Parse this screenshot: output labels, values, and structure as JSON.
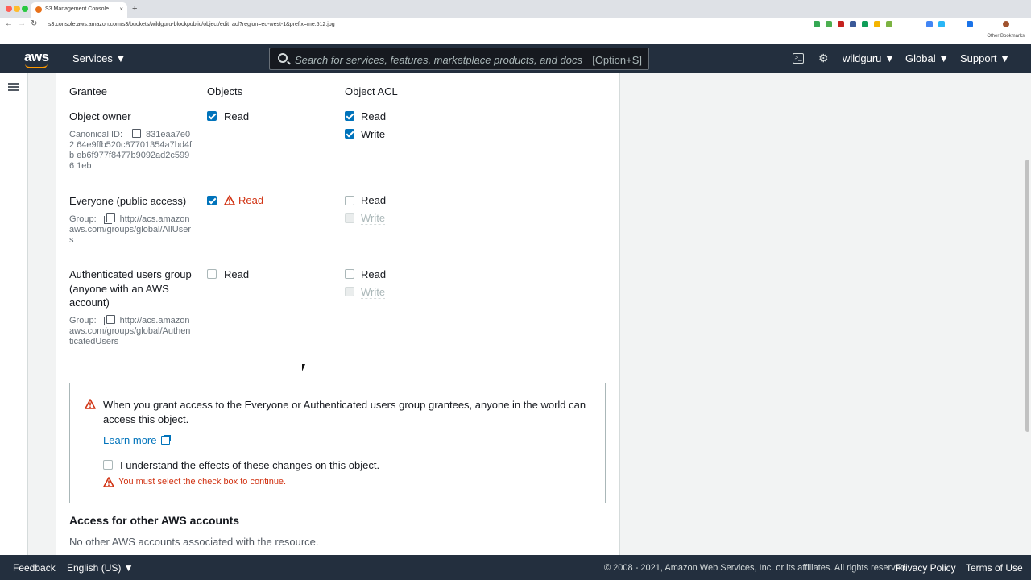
{
  "browser": {
    "tab_title": "S3 Management Console",
    "new_tab": "+",
    "close": "×",
    "url": "s3.console.aws.amazon.com/s3/buckets/wildguru-blockpublic/object/edit_acl?region=eu-west-1&prefix=me.512.jpg",
    "other_bookmarks": "Other Bookmarks"
  },
  "header": {
    "logo": "aws",
    "services": "Services ▼",
    "search_placeholder": "Search for services, features, marketplace products, and docs",
    "search_shortcut": "[Option+S]",
    "cloudshell": ">_",
    "bell": "🔔",
    "account": "wildguru ▼",
    "region": "Global ▼",
    "support": "Support ▼"
  },
  "acl": {
    "col_grantee": "Grantee",
    "col_objects": "Objects",
    "col_object_acl": "Object ACL",
    "rows": [
      {
        "name": "Object owner",
        "meta_label": "Canonical ID:",
        "meta_value": "831eaa7e02 64e9ffb520c87701354a7bd4fb eb6f977f8477b9092ad2c5996 1eb",
        "objects_read": "Read",
        "acl_read": "Read",
        "acl_write": "Write"
      },
      {
        "name": "Everyone (public access)",
        "meta_label": "Group:",
        "meta_value": "http://acs.amazon aws.com/groups/global/AllUser s",
        "objects_read": "Read",
        "acl_read": "Read",
        "acl_write": "Write"
      },
      {
        "name": "Authenticated users group (anyone with an AWS account)",
        "meta_label": "Group:",
        "meta_value": "http://acs.amazon aws.com/groups/global/Authen ticatedUsers",
        "objects_read": "Read",
        "acl_read": "Read",
        "acl_write": "Write"
      }
    ]
  },
  "alert": {
    "message": "When you grant access to the Everyone or Authenticated users group grantees, anyone in the world can access this object.",
    "learn_more": "Learn more",
    "acknowledge": "I understand the effects of these changes on this object.",
    "error": "You must select the check box to continue."
  },
  "other_accounts": {
    "title": "Access for other AWS accounts",
    "body": "No other AWS accounts associated with the resource."
  },
  "footer": {
    "feedback": "Feedback",
    "language": "English (US) ▼",
    "copyright": "© 2008 - 2021, Amazon Web Services, Inc. or its affiliates. All rights reserved.",
    "privacy": "Privacy Policy",
    "terms": "Terms of Use"
  },
  "colors": {
    "header_bg": "#232f3e",
    "accent": "#ff9900",
    "link": "#0073bb",
    "error": "#d13212"
  }
}
